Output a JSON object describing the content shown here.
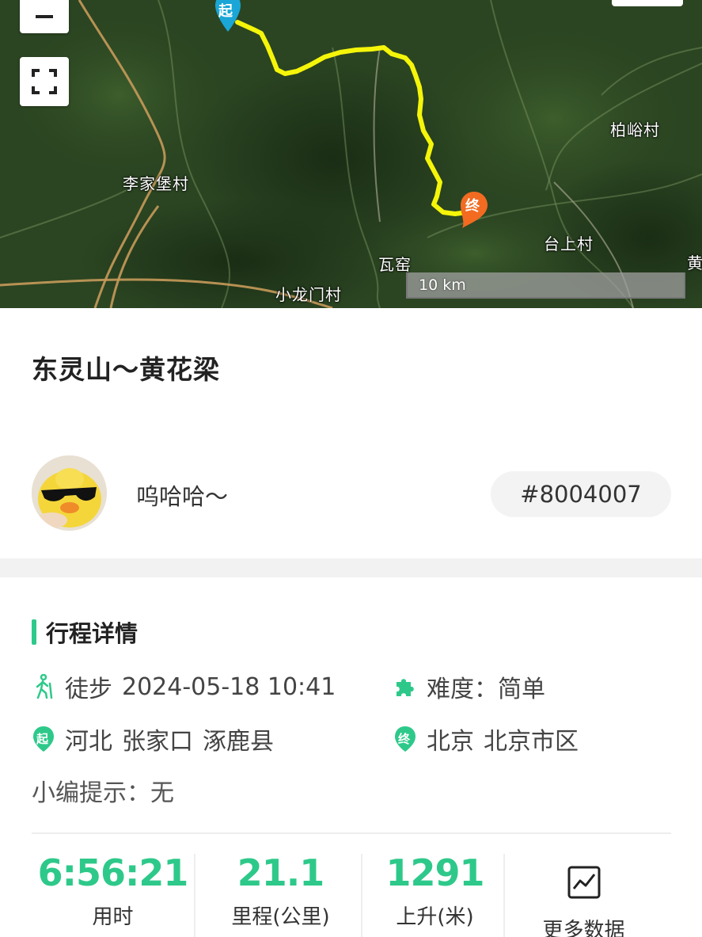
{
  "map": {
    "places": [
      "柏峪村",
      "李家堡村",
      "台上村",
      "瓦窑",
      "小龙门村",
      "黄"
    ],
    "start_marker": "起",
    "end_marker": "终",
    "scale_label": "10 km",
    "route_color": "#f5f50a",
    "icons": [
      "zoom-out-icon",
      "fullscreen-icon"
    ]
  },
  "trip": {
    "title": "东灵山～黄花梁",
    "username": "呜哈哈～",
    "trip_id": "#8004007"
  },
  "details": {
    "section_title": "行程详情",
    "mode": "徒步",
    "datetime": "2024-05-18 10:41",
    "difficulty_label": "难度：",
    "difficulty": "简单",
    "start_marker": "起",
    "start_province": "河北",
    "start_city": "张家口",
    "start_county": "涿鹿县",
    "end_marker": "终",
    "end_province": "北京",
    "end_city": "北京市区",
    "tip_label": "小编提示：",
    "tip": "无"
  },
  "stats": [
    {
      "value": "6:56:21",
      "label": "用时"
    },
    {
      "value": "21.1",
      "label": "里程(公里)"
    },
    {
      "value": "1291",
      "label": "上升(米)"
    }
  ],
  "more": {
    "label": "更多数据",
    "icon": "chart-icon"
  },
  "colors": {
    "accent": "#2ec98a",
    "start_pin": "#1aa6d6",
    "end_pin": "#f26b21"
  }
}
